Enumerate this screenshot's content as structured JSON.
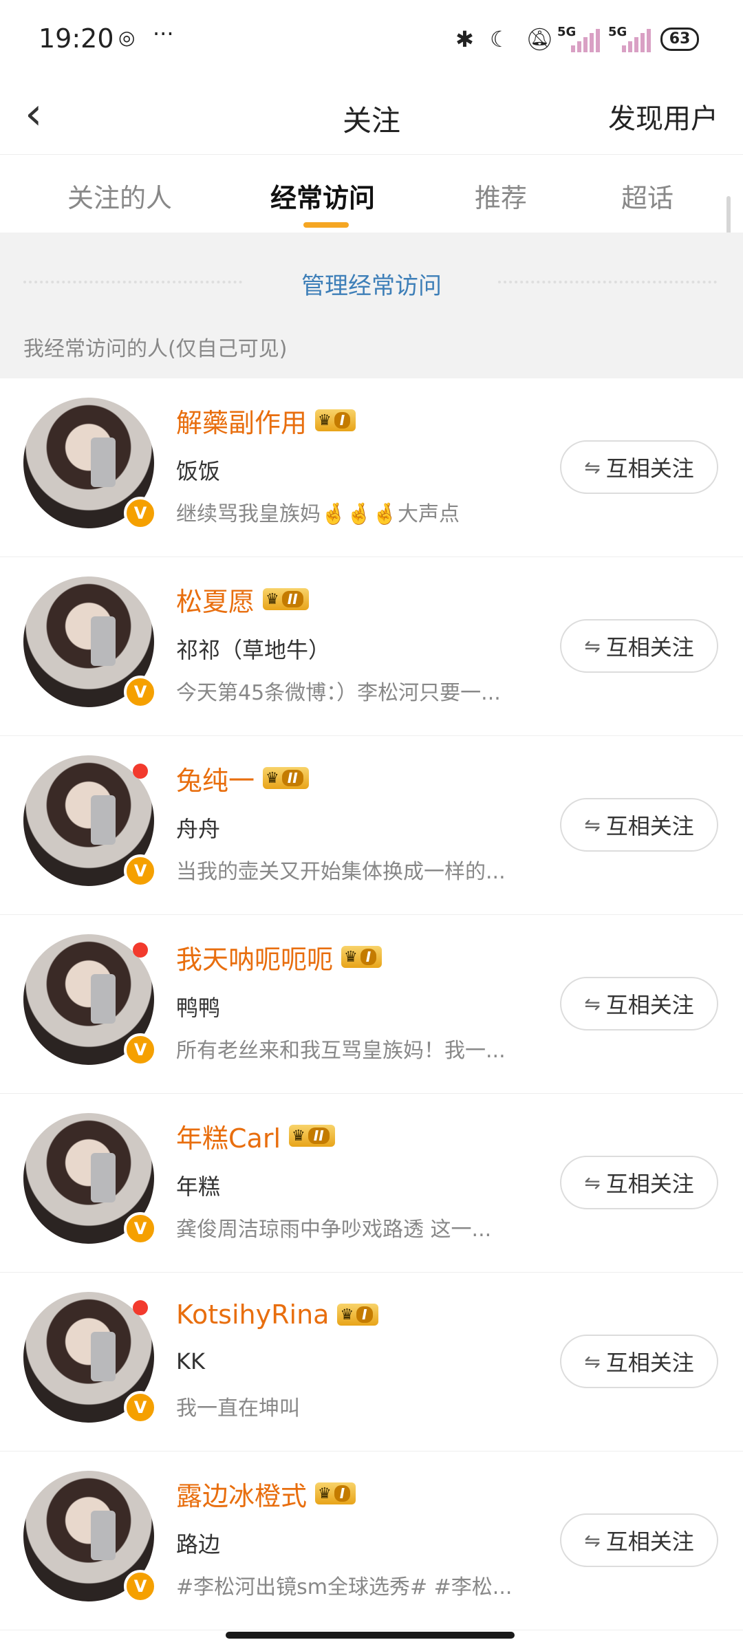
{
  "status_bar": {
    "time": "19:20",
    "left_icons": [
      "screen-record-icon",
      "more-dots-icon"
    ],
    "right_icons": [
      "bluetooth-icon",
      "moon-icon",
      "bell-muted-icon",
      "signal-5g-icon",
      "signal-5g-icon"
    ],
    "network_1": "5G",
    "network_2": "5G",
    "battery": "63"
  },
  "nav": {
    "title": "关注",
    "right_link": "发现用户"
  },
  "tabs": [
    "关注的人",
    "经常访问",
    "推荐",
    "超话"
  ],
  "active_tab": "经常访问",
  "section": {
    "manage_label": "管理经常访问",
    "hint": "我经常访问的人(仅自己可见)"
  },
  "colors": {
    "accent": "#f5a623",
    "name": "#e86e0e",
    "link": "#3e7fb8",
    "red_dot": "#f23a2d"
  },
  "follow_label": "互相关注",
  "users": [
    {
      "name": "解藥副作用",
      "level": "I",
      "nick": "饭饭",
      "desc": "继续骂我皇族妈🤞🤞🤞大声点",
      "dot": false
    },
    {
      "name": "松夏愿",
      "level": "II",
      "nick": "祁祁（草地牛）",
      "desc": "今天第45条微博：）李松河只要一...",
      "dot": false
    },
    {
      "name": "兔纯一",
      "level": "II",
      "nick": "舟舟",
      "desc": "当我的壶关又开始集体换成一样的...",
      "dot": true
    },
    {
      "name": "我天呐呃呃呃",
      "level": "I",
      "nick": "鸭鸭",
      "desc": "所有老丝来和我互骂皇族妈！我一...",
      "dot": true
    },
    {
      "name": "年糕Carl",
      "level": "II",
      "nick": "年糕",
      "desc": "龚俊周洁琼雨中争吵戏路透 这一...",
      "dot": false
    },
    {
      "name": "KotsihyRina",
      "level": "I",
      "nick": "KK",
      "desc": "我一直在坤叫",
      "dot": true
    },
    {
      "name": "露边冰橙式",
      "level": "I",
      "nick": "路边",
      "desc": "#李松河出镜sm全球选秀# #李松...",
      "dot": false
    }
  ]
}
